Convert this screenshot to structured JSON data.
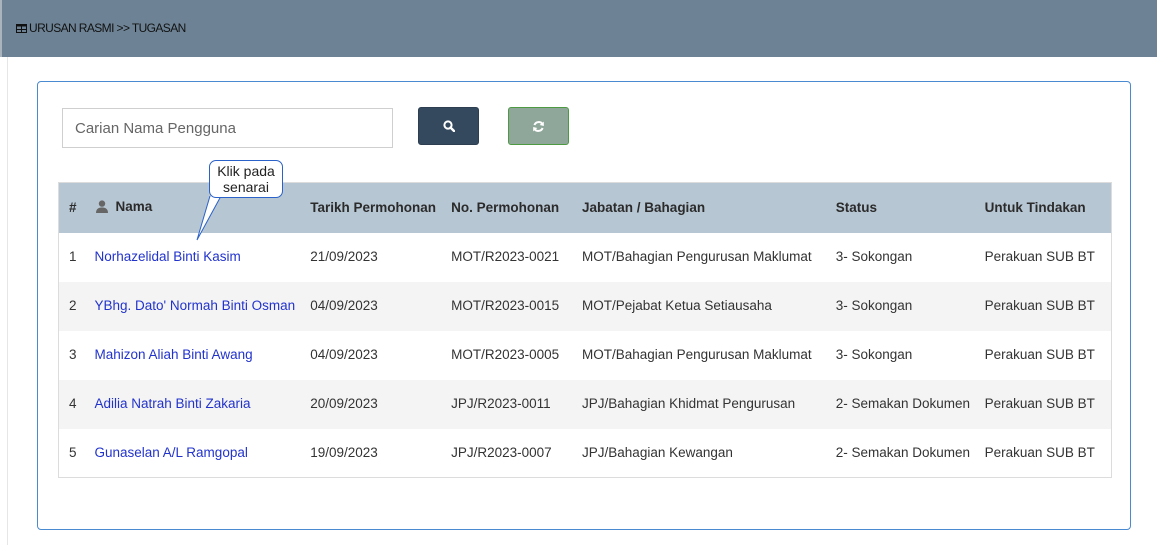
{
  "breadcrumb": {
    "icon": "table-grid-icon",
    "text": "URUSAN RASMI >> TUGASAN"
  },
  "search": {
    "placeholder": "Carian Nama Pengguna",
    "value": "",
    "search_icon": "magnifier-icon",
    "reset_icon": "refresh-icon"
  },
  "callout": {
    "line1": "Klik pada",
    "line2": "senarai"
  },
  "table": {
    "headers": {
      "no": "#",
      "name": "Nama",
      "name_icon": "user-icon",
      "date": "Tarikh Permohonan",
      "app_no": "No. Permohonan",
      "dept": "Jabatan / Bahagian",
      "status": "Status",
      "action": "Untuk Tindakan"
    },
    "rows": [
      {
        "no": "1",
        "name": "Norhazelidal Binti Kasim",
        "date": "21/09/2023",
        "app_no": "MOT/R2023-0021",
        "dept": "MOT/Bahagian Pengurusan Maklumat",
        "status": "3- Sokongan",
        "action": "Perakuan SUB BT"
      },
      {
        "no": "2",
        "name": "YBhg. Dato' Normah Binti Osman",
        "date": "04/09/2023",
        "app_no": "MOT/R2023-0015",
        "dept": "MOT/Pejabat Ketua Setiausaha",
        "status": "3- Sokongan",
        "action": "Perakuan SUB BT"
      },
      {
        "no": "3",
        "name": "Mahizon Aliah Binti Awang",
        "date": "04/09/2023",
        "app_no": "MOT/R2023-0005",
        "dept": "MOT/Bahagian Pengurusan Maklumat",
        "status": "3- Sokongan",
        "action": "Perakuan SUB BT"
      },
      {
        "no": "4",
        "name": "Adilia Natrah Binti Zakaria",
        "date": "20/09/2023",
        "app_no": "JPJ/R2023-0011",
        "dept": "JPJ/Bahagian Khidmat Pengurusan",
        "status": "2- Semakan Dokumen",
        "action": "Perakuan SUB BT"
      },
      {
        "no": "5",
        "name": "Gunaselan A/L Ramgopal",
        "date": "19/09/2023",
        "app_no": "JPJ/R2023-0007",
        "dept": "JPJ/Bahagian Kewangan",
        "status": "2- Semakan Dokumen",
        "action": "Perakuan SUB BT"
      }
    ]
  },
  "colors": {
    "topbar": "#6d8395",
    "panel_border": "#4a8ad0",
    "table_header": "#b7c6d3",
    "link": "#2233cc",
    "search_button": "#34495e",
    "reset_button": "#8fa79a"
  }
}
